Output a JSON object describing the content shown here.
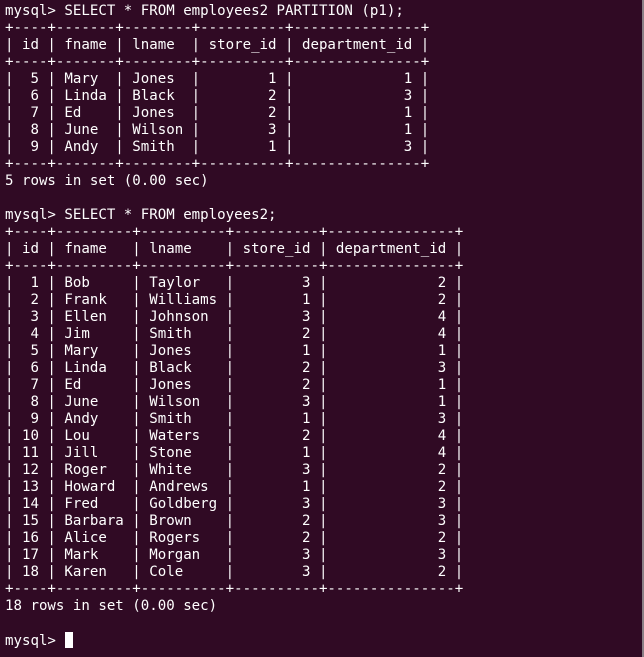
{
  "colors": {
    "background": "#300a24",
    "text": "#ffffff",
    "highlight_underline": "#0a8fd0"
  },
  "prompt": "mysql> ",
  "query1": {
    "command": "SELECT * FROM employees2 PARTITION (p1);",
    "lines": [
      "+----+-------+--------+----------+---------------+",
      "| id | fname | lname  | store_id | department_id |",
      "+----+-------+--------+----------+---------------+",
      "|  5 | Mary  | Jones  |        1 |             1 |",
      "|  6 | Linda | Black  |        2 |             3 |",
      "|  7 | Ed    | Jones  |        2 |             1 |",
      "|  8 | June  | Wilson |        3 |             1 |",
      "|  9 | Andy  | Smith  |        1 |             3 |",
      "+----+-------+--------+----------+---------------+"
    ],
    "status": "5 rows in set (0.00 sec)"
  },
  "query2": {
    "command": "SELECT * FROM employees2;",
    "lines": [
      "+----+---------+----------+----------+---------------+",
      "| id | fname   | lname    | store_id | department_id |",
      "+----+---------+----------+----------+---------------+",
      "|  1 | Bob     | Taylor   |        3 |             2 |",
      "|  2 | Frank   | Williams |        1 |             2 |",
      "|  3 | Ellen   | Johnson  |        3 |             4 |",
      "|  4 | Jim     | Smith    |        2 |             4 |",
      "|  5 | Mary    | Jones    |        1 |             1 |",
      "|  6 | Linda   | Black    |        2 |             3 |",
      "|  7 | Ed      | Jones    |        2 |             1 |",
      "|  8 | June    | Wilson   |        3 |             1 |",
      "|  9 | Andy    | Smith    |        1 |             3 |",
      "| 10 | Lou     | Waters   |        2 |             4 |",
      "| 11 | Jill    | Stone    |        1 |             4 |",
      "| 12 | Roger   | White    |        3 |             2 |",
      "| 13 | Howard  | Andrews  |        1 |             2 |",
      "| 14 | Fred    | Goldberg |        3 |             3 |",
      "| 15 | Barbara | Brown    |        2 |             3 |",
      "| 16 | Alice   | Rogers   |        2 |             2 |",
      "| 17 | Mark    | Morgan   |        3 |             3 |",
      "| 18 | Karen   | Cole     |        3 |             2 |",
      "+----+---------+----------+----------+---------------+"
    ],
    "status": "18 rows in set (0.00 sec)"
  }
}
